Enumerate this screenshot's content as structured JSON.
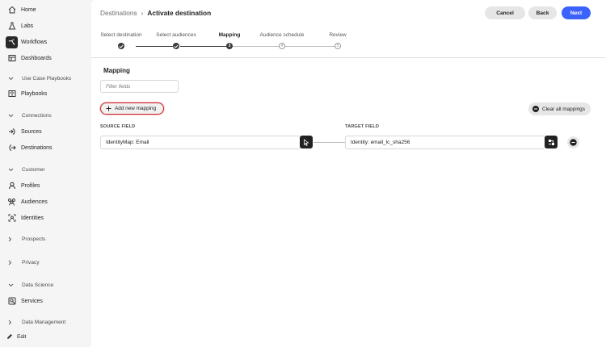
{
  "sidebar": {
    "items": [
      {
        "label": "Home",
        "icon": "home-icon"
      },
      {
        "label": "Labs",
        "icon": "flask-icon"
      },
      {
        "label": "Workflows",
        "icon": "workflow-icon",
        "active": true
      },
      {
        "label": "Dashboards",
        "icon": "dashboard-icon"
      }
    ],
    "sections": {
      "use_case_playbooks": "Use Case Playbooks",
      "playbooks": "Playbooks",
      "connections": "Connections",
      "sources": "Sources",
      "destinations": "Destinations",
      "customer": "Customer",
      "profiles": "Profiles",
      "audiences": "Audiences",
      "identities": "Identities",
      "prospects": "Prospects",
      "privacy": "Privacy",
      "data_science": "Data Science",
      "services": "Services",
      "data_management": "Data Management"
    },
    "edit_label": "Edit"
  },
  "header": {
    "breadcrumb_parent": "Destinations",
    "breadcrumb_separator": "›",
    "breadcrumb_current": "Activate destination",
    "cancel_label": "Cancel",
    "back_label": "Back",
    "next_label": "Next"
  },
  "steps": [
    {
      "label": "Select destination",
      "state": "done"
    },
    {
      "label": "Select audiences",
      "state": "done"
    },
    {
      "label": "Mapping",
      "state": "current",
      "number": "3"
    },
    {
      "label": "Audience schedule",
      "state": "todo",
      "number": "4"
    },
    {
      "label": "Review",
      "state": "todo",
      "number": "5"
    }
  ],
  "mapping": {
    "title": "Mapping",
    "filter_placeholder": "Filter fields",
    "add_label": "Add new mapping",
    "clear_label": "Clear all mappings",
    "source_header": "SOURCE FIELD",
    "target_header": "TARGET FIELD",
    "rows": [
      {
        "source": "IdentityMap: Email",
        "target": "Identity: email_lc_sha256"
      }
    ]
  },
  "colors": {
    "accent": "#3b63fb",
    "highlight_outline": "#c9252d"
  }
}
